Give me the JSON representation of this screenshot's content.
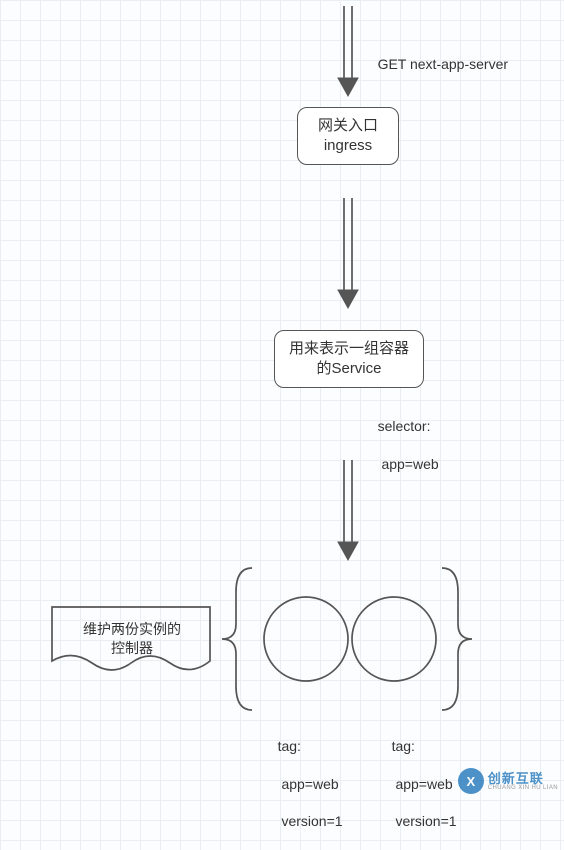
{
  "chart_data": {
    "type": "diagram",
    "title": "",
    "flow": [
      {
        "id": "request",
        "kind": "label",
        "text": "GET next-app-server"
      },
      {
        "id": "ingress",
        "kind": "node",
        "text": "网关入口\ningress"
      },
      {
        "id": "service",
        "kind": "node",
        "text": "用来表示一组容器\n的Service"
      },
      {
        "id": "selector",
        "kind": "label",
        "text": "selector:\n app=web"
      },
      {
        "id": "controller",
        "kind": "note",
        "text": "维护两份实例的\n控制器"
      },
      {
        "id": "pod1",
        "kind": "pod",
        "tag_label": "tag:\n app=web\n version=1"
      },
      {
        "id": "pod2",
        "kind": "pod",
        "tag_label": "tag:\n app=web\n version=1"
      }
    ],
    "edges": [
      [
        "request",
        "ingress"
      ],
      [
        "ingress",
        "service"
      ],
      [
        "service",
        "pods"
      ]
    ]
  },
  "labels": {
    "request": "GET next-app-server",
    "ingress_l1": "网关入口",
    "ingress_l2": "ingress",
    "service_l1": "用来表示一组容器",
    "service_l2": "的Service",
    "selector_l1": "selector:",
    "selector_l2": " app=web",
    "controller_l1": "维护两份实例的",
    "controller_l2": "控制器",
    "tag_label": "tag:",
    "tag_app": " app=web",
    "tag_ver": " version=1"
  },
  "watermark": {
    "icon_letter": "X",
    "cn": "创新互联",
    "en": "CHUANG XIN HU LIAN"
  }
}
